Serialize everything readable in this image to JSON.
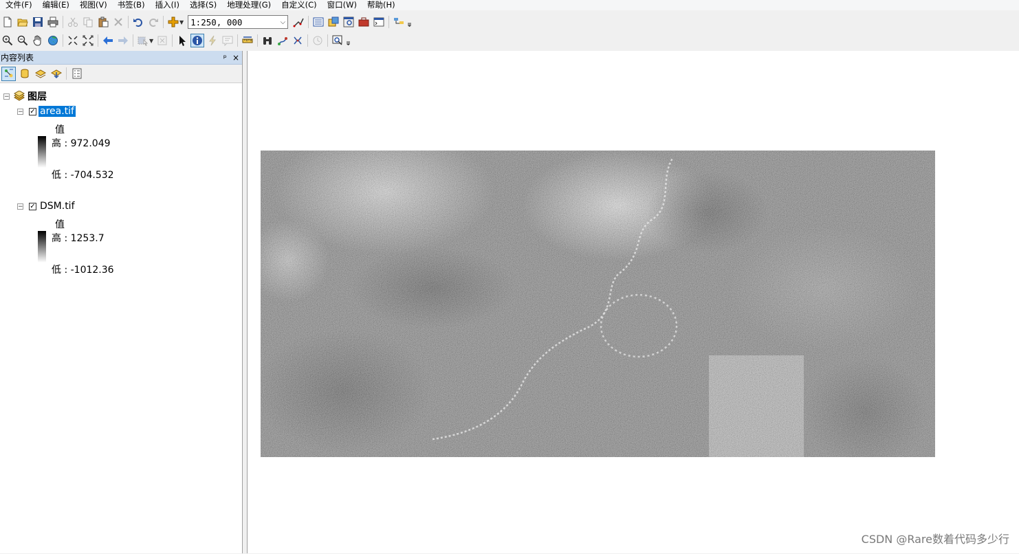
{
  "menu": [
    "文件(F)",
    "编辑(E)",
    "视图(V)",
    "书签(B)",
    "插入(I)",
    "选择(S)",
    "地理处理(G)",
    "自定义(C)",
    "窗口(W)",
    "帮助(H)"
  ],
  "toolbar": {
    "scale_value": "1:250, 000"
  },
  "toc": {
    "title": "内容列表",
    "pin_label": "ᵖ",
    "close_label": "×",
    "root_label": "图层",
    "layers": [
      {
        "name": "area.tif",
        "value_label": "值",
        "high": "高 : 972.049",
        "low": "低 : -704.532",
        "checked": true,
        "selected": true
      },
      {
        "name": "DSM.tif",
        "value_label": "值",
        "high": "高 : 1253.7",
        "low": "低 : -1012.36",
        "checked": true,
        "selected": false
      }
    ]
  },
  "watermark": "CSDN @Rare数着代码多少行"
}
